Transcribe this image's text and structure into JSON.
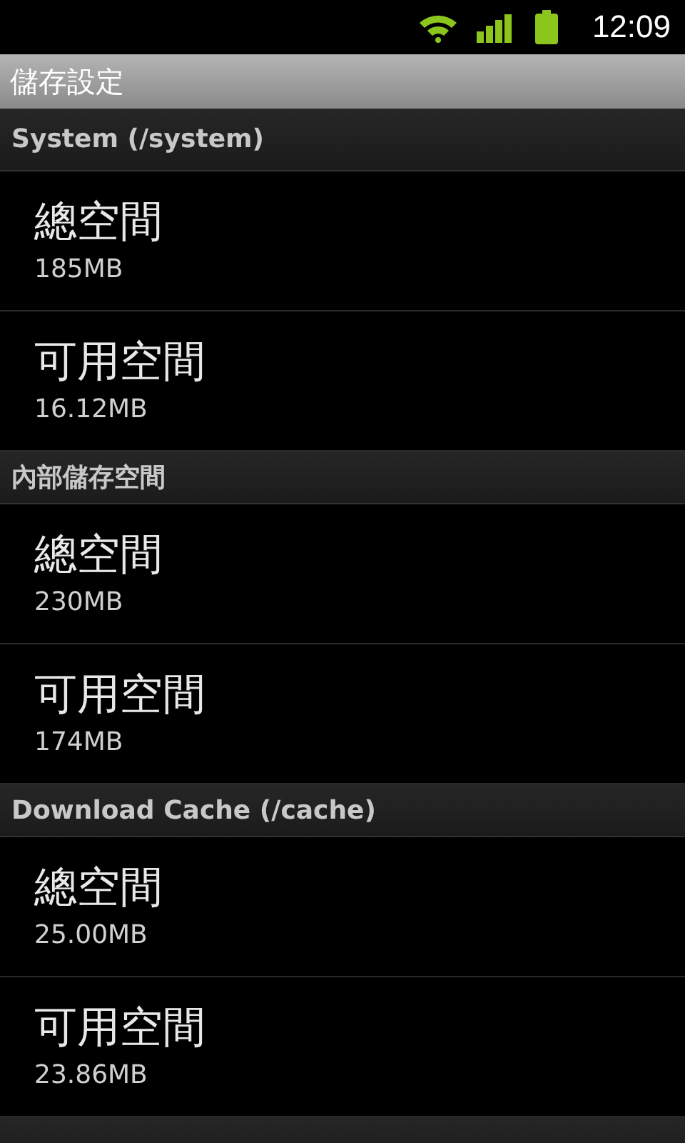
{
  "status_bar": {
    "time": "12:09"
  },
  "title": "儲存設定",
  "sections": [
    {
      "header": "System (/system)",
      "items": [
        {
          "title": "總空間",
          "value": "185MB"
        },
        {
          "title": "可用空間",
          "value": "16.12MB"
        }
      ]
    },
    {
      "header": "內部儲存空間",
      "items": [
        {
          "title": "總空間",
          "value": "230MB"
        },
        {
          "title": "可用空間",
          "value": "174MB"
        }
      ]
    },
    {
      "header": "Download Cache (/cache)",
      "items": [
        {
          "title": "總空間",
          "value": "25.00MB"
        },
        {
          "title": "可用空間",
          "value": "23.86MB"
        }
      ]
    }
  ]
}
